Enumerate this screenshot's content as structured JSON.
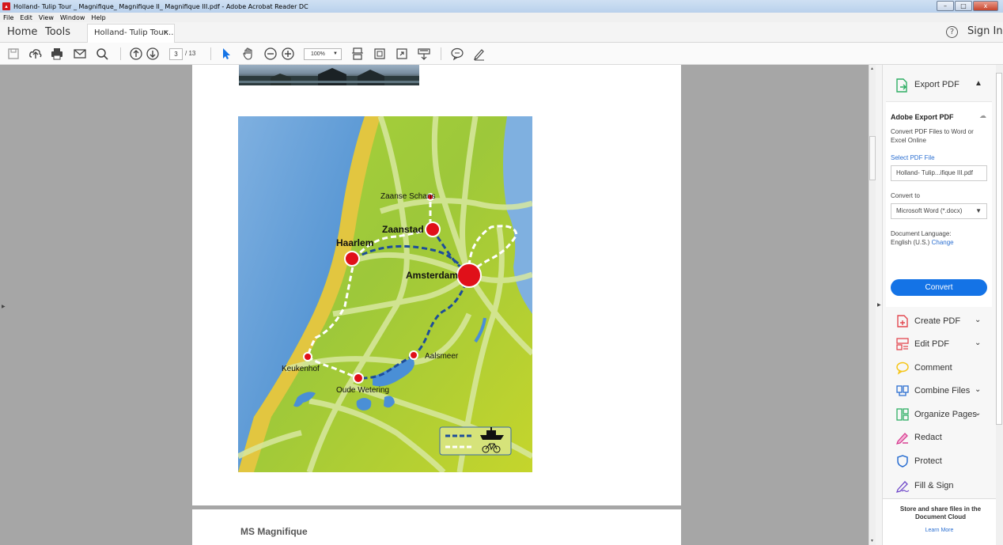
{
  "window": {
    "title": "Holland- Tulip Tour _ Magnifique_ Magnifique II_ Magnifique III.pdf - Adobe Acrobat Reader DC",
    "controls": [
      "–",
      "□",
      "x"
    ]
  },
  "menu": [
    "File",
    "Edit",
    "View",
    "Window",
    "Help"
  ],
  "tabs": {
    "home": "Home",
    "tools": "Tools",
    "document": "Holland- Tulip Tour...",
    "document_close": "×",
    "help": "?",
    "sign_in": "Sign In"
  },
  "toolbar": {
    "page_current": "3",
    "page_total": "/ 13",
    "zoom": "100%"
  },
  "map": {
    "places": [
      "Zaanse Schans",
      "Zaanstad",
      "Haarlem",
      "Amsterdam",
      "Aalsmeer",
      "Keukenhof",
      "Oude Wetering"
    ]
  },
  "page2": {
    "heading": "MS Magnifique"
  },
  "right_pane": {
    "export_pdf": "Export PDF",
    "adobe_export_title": "Adobe Export PDF",
    "description": "Convert PDF Files to Word or Excel Online",
    "select_file": "Select PDF File",
    "file_name": "Holland- Tulip...ifique III.pdf",
    "convert_to": "Convert to",
    "format": "Microsoft Word (*.docx)",
    "doc_language_label": "Document Language:",
    "language": "English (U.S.)",
    "change": "Change",
    "convert_button": "Convert",
    "tools": [
      {
        "label": "Create PDF",
        "icon": "create-pdf-icon",
        "color": "#e34850"
      },
      {
        "label": "Edit PDF",
        "icon": "edit-pdf-icon",
        "color": "#e34850"
      },
      {
        "label": "Comment",
        "icon": "comment-icon",
        "color": "#f5c518"
      },
      {
        "label": "Combine Files",
        "icon": "combine-files-icon",
        "color": "#2b6fd1"
      },
      {
        "label": "Organize Pages",
        "icon": "organize-pages-icon",
        "color": "#2fae64"
      },
      {
        "label": "Redact",
        "icon": "redact-icon",
        "color": "#d6338c"
      },
      {
        "label": "Protect",
        "icon": "protect-icon",
        "color": "#2b6fd1"
      },
      {
        "label": "Fill & Sign",
        "icon": "fill-sign-icon",
        "color": "#6f48c9"
      }
    ],
    "cloud_text": "Store and share files in the Document Cloud",
    "learn_more": "Learn More"
  }
}
